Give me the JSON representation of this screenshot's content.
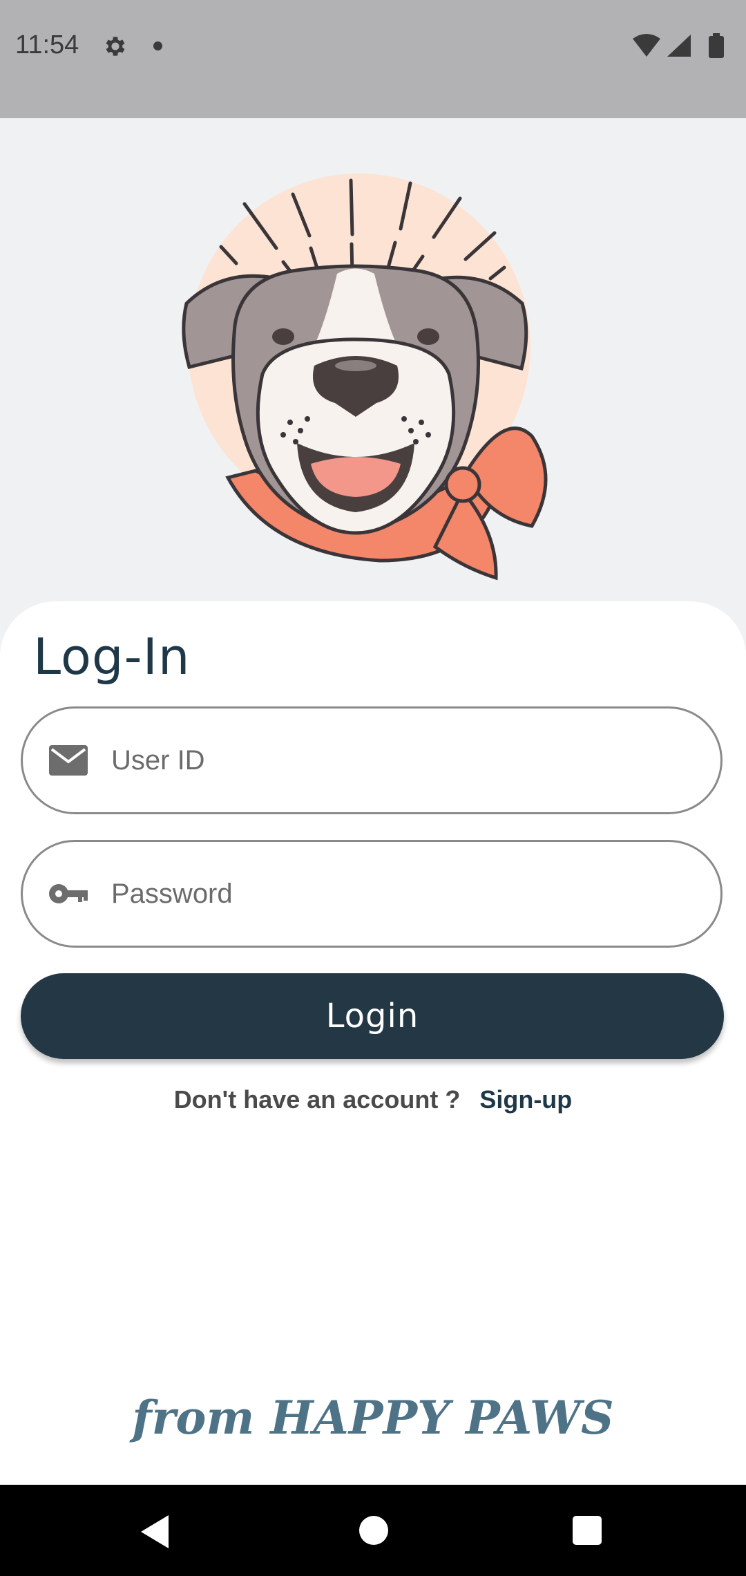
{
  "status_bar": {
    "time": "11:54",
    "icons": [
      "gear-icon",
      "notification-dot",
      "wifi-icon",
      "signal-icon",
      "battery-icon"
    ]
  },
  "login": {
    "title": "Log-In",
    "user_id_placeholder": "User ID",
    "password_placeholder": "Password",
    "login_button": "Login",
    "signup_prompt": "Don't have an account ?",
    "signup_link": "Sign-up"
  },
  "footer": {
    "brand": "from HAPPY PAWS"
  },
  "colors": {
    "primary": "#233744",
    "title": "#1f3848",
    "brand": "#4e7387",
    "scarf": "#f4876a",
    "background": "#f0f1f3"
  }
}
